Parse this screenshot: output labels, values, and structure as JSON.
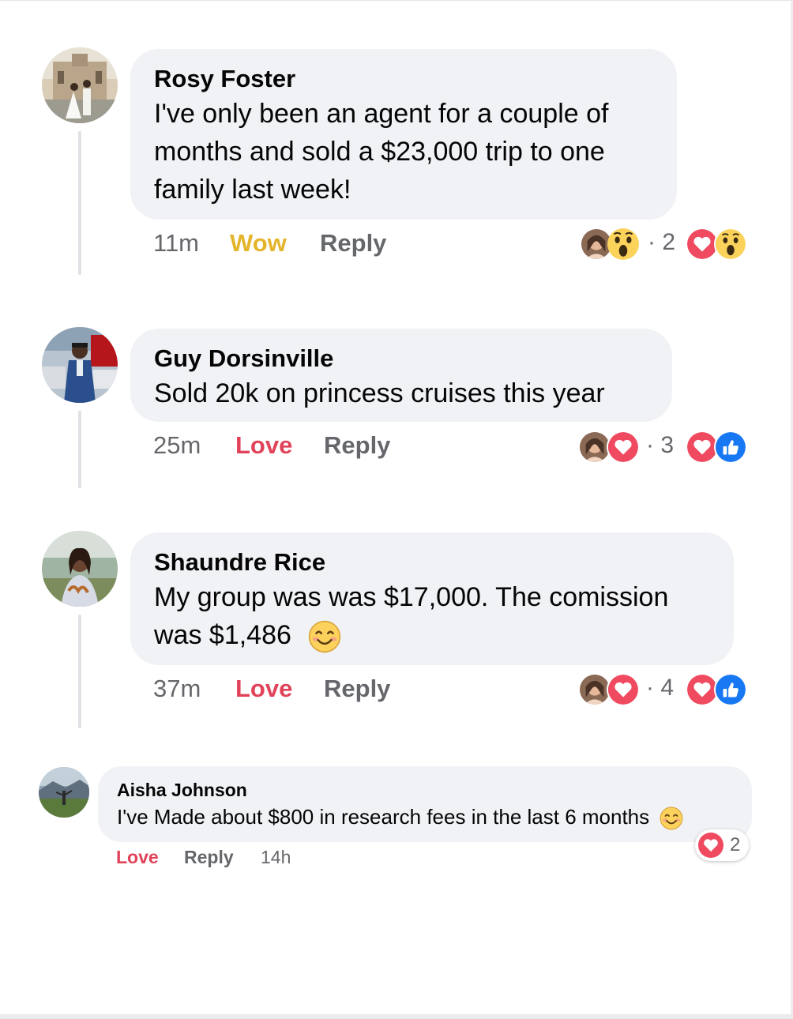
{
  "colors": {
    "bubble": "#f0f2f5",
    "secondary_text": "#65676b",
    "wow": "#e4b52b",
    "love": "#e0435a",
    "like": "#1877f2"
  },
  "comments": [
    {
      "author": "Rosy Foster",
      "lines": [
        "I've only been an agent for a couple of",
        "months and sold a $23,000 trip to one",
        "family last week!"
      ],
      "time": "11m",
      "reaction_action": "Wow",
      "reply": "Reply",
      "reaction_count": "2",
      "icons": [
        "profile-thumb",
        "wow-emoji",
        "love-reaction",
        "wow-reaction"
      ]
    },
    {
      "author": "Guy Dorsinville",
      "lines": [
        "Sold 20k on princess cruises this year"
      ],
      "time": "25m",
      "reaction_action": "Love",
      "reply": "Reply",
      "reaction_count": "3",
      "icons": [
        "profile-thumb",
        "love-reaction",
        "love-reaction",
        "like-reaction"
      ]
    },
    {
      "author": "Shaundre Rice",
      "lines": [
        "My group was was $17,000. The comission",
        "was $1,486"
      ],
      "time": "37m",
      "reaction_action": "Love",
      "reply": "Reply",
      "reaction_count": "4",
      "icons": [
        "profile-thumb",
        "love-reaction",
        "love-reaction",
        "like-reaction"
      ]
    },
    {
      "author": "Aisha Johnson",
      "lines": [
        "I've Made about $800 in research fees in the last 6 months"
      ],
      "time": "14h",
      "reaction_action": "Love",
      "reply": "Reply",
      "reaction_count": "2",
      "icons": [
        "love-reaction"
      ]
    }
  ]
}
